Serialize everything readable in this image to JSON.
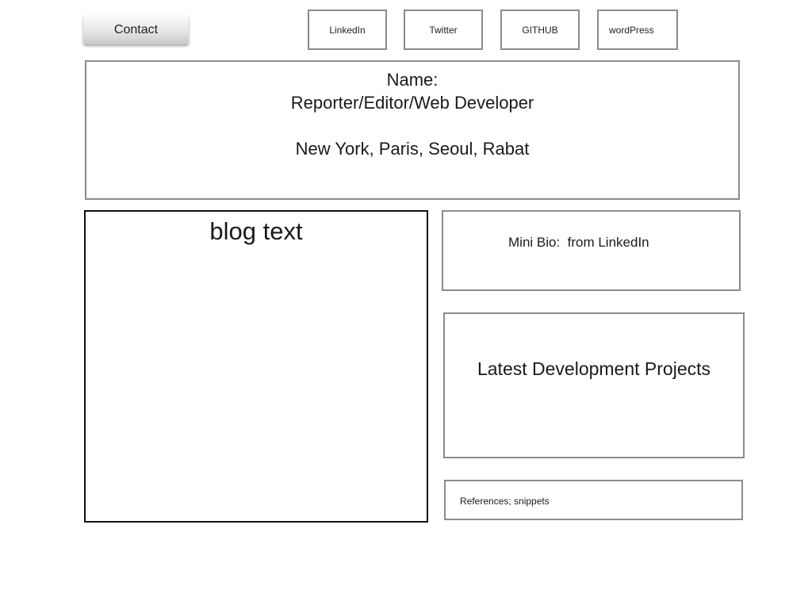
{
  "nav": {
    "contact_label": "Contact",
    "social_links": [
      "LinkedIn",
      "Twitter",
      "GITHUB",
      "wordPress"
    ]
  },
  "header": {
    "name_label": "Name:",
    "roles": "Reporter/Editor/Web Developer",
    "locations": "New York, Paris, Seoul, Rabat"
  },
  "blog": {
    "title": "blog text"
  },
  "sidebar": {
    "mini_bio": "Mini Bio:  from LinkedIn",
    "projects_title": "Latest Development Projects",
    "references": "References; snippets"
  },
  "colors": {
    "border_gray": "#8c8c8c",
    "border_dark": "#111111",
    "text": "#1a1a1a"
  }
}
